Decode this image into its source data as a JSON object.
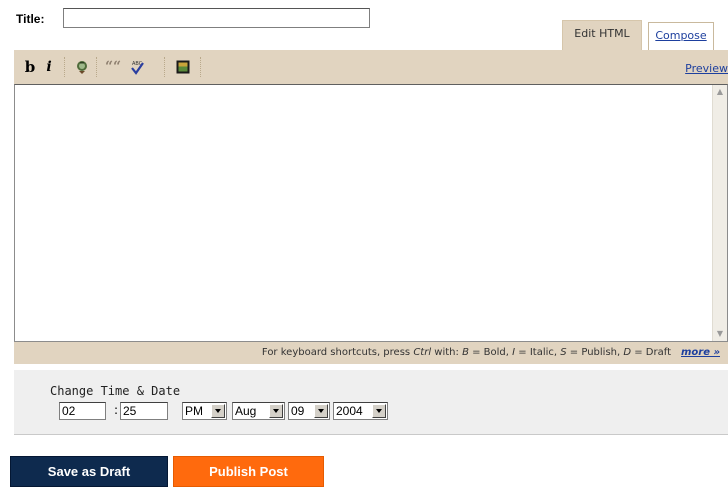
{
  "title": {
    "label": "Title:",
    "value": ""
  },
  "tabs": [
    {
      "label": "Edit HTML",
      "active": true
    },
    {
      "label": "Compose",
      "active": false
    }
  ],
  "toolbar": {
    "bold_label": "b",
    "italic_label": "i",
    "quote_label": "““",
    "preview_label": "Preview",
    "icons": [
      "bold",
      "italic",
      "link-icon",
      "blockquote-icon",
      "spellcheck-icon",
      "image-icon"
    ]
  },
  "editor": {
    "content": ""
  },
  "shortcuts": {
    "prefix": "For keyboard shortcuts, press ",
    "ctrl": "Ctrl",
    "with": " with: ",
    "b_key": "B",
    "b_text": " = Bold, ",
    "i_key": "I",
    "i_text": " = Italic, ",
    "s_key": "S",
    "s_text": " = Publish, ",
    "d_key": "D",
    "d_text": " = Draft",
    "more_label": "more »"
  },
  "datetime": {
    "label": "Change Time & Date",
    "hour": "02",
    "separator": ":",
    "minute": "25",
    "ampm": "PM",
    "month": "Aug",
    "day": "09",
    "year": "2004"
  },
  "actions": {
    "save_draft_label": "Save as Draft",
    "publish_label": "Publish Post"
  },
  "colors": {
    "toolbar_bg": "#e1d4c0",
    "save_btn": "#0e2a4e",
    "publish_btn": "#ff6a0d",
    "link": "#1d3f9e"
  }
}
